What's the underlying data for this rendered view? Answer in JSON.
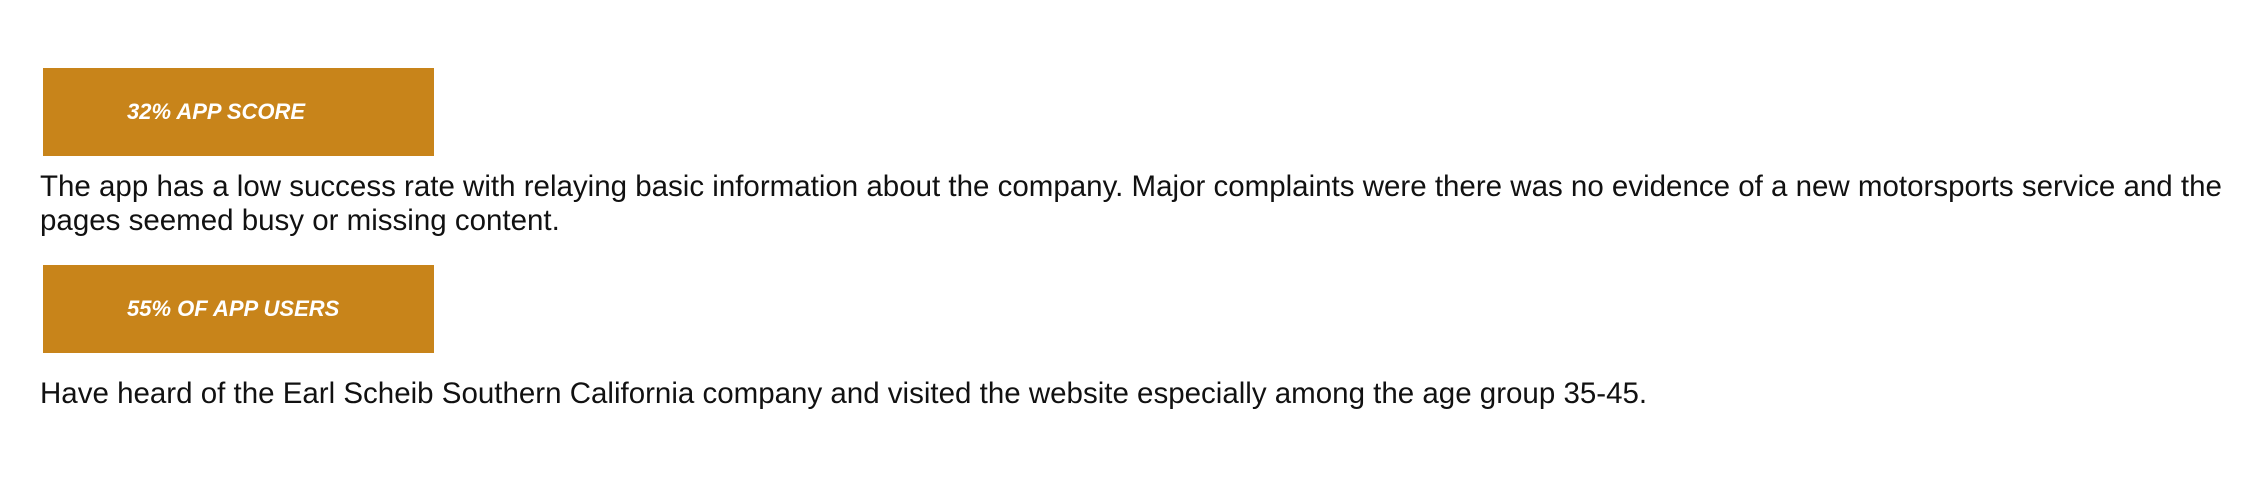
{
  "sections": [
    {
      "banner_label": "32% APP SCORE",
      "text": "The app has a low success rate with relaying basic information about the company. Major complaints were there was no evidence of a new motorsports service and the pages seemed busy or missing content."
    },
    {
      "banner_label": "55% OF APP USERS",
      "text": "Have heard of the Earl Scheib Southern California company and visited the website especially among the age group 35-45."
    }
  ],
  "colors": {
    "banner_background": "#c8841a",
    "banner_text": "#ffffff",
    "body_text": "#111111",
    "page_background": "#ffffff"
  }
}
